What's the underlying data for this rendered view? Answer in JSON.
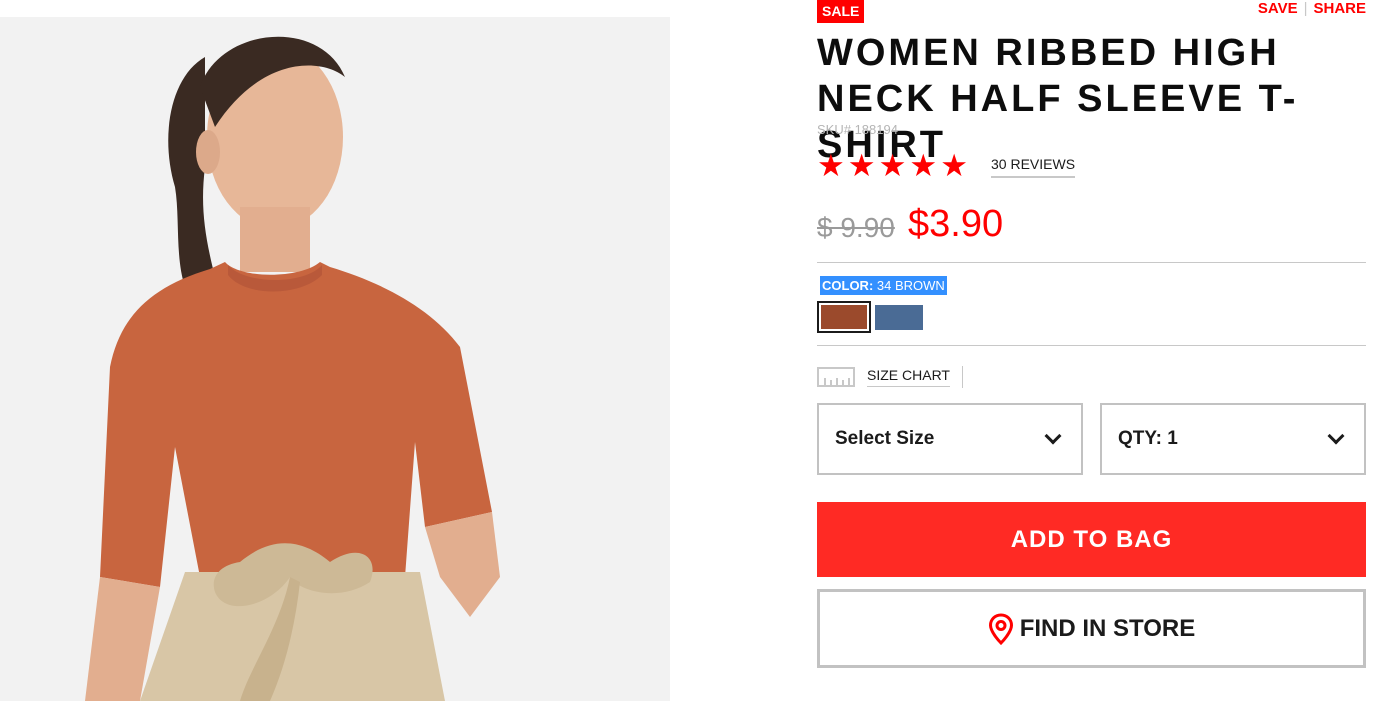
{
  "product": {
    "sale_badge": "SALE",
    "save_label": "SAVE",
    "share_label": "SHARE",
    "title": "WOMEN RIBBED HIGH NECK HALF SLEEVE T-SHIRT",
    "sku": "SKU# 188194",
    "rating": 5,
    "reviews_label": "30 REVIEWS",
    "old_price": "$ 9.90",
    "new_price": "$3.90",
    "color_label": "COLOR:",
    "color_value": "34 BROWN",
    "swatches": [
      {
        "name": "brown",
        "hex": "#9b4a2c",
        "selected": true
      },
      {
        "name": "blue",
        "hex": "#4a6b95",
        "selected": false
      }
    ],
    "size_chart_label": "SIZE CHART",
    "size_select_label": "Select Size",
    "qty_label": "QTY: 1",
    "add_to_bag_label": "ADD TO BAG",
    "find_in_store_label": "FIND IN STORE"
  },
  "colors": {
    "accent": "#ff0000",
    "button_red": "#ff2a24",
    "border": "#c2c2c2",
    "selection": "#3390ff"
  },
  "icons": [
    "star-icon",
    "ruler-icon",
    "chevron-down-icon",
    "location-pin-icon"
  ]
}
